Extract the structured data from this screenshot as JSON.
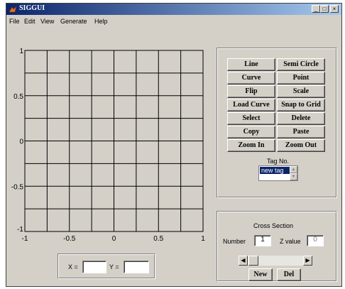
{
  "window": {
    "title": "SIGGUI",
    "controls": [
      "_",
      "□",
      "×"
    ]
  },
  "menu": [
    "File",
    "Edit",
    "View",
    "Generate",
    "Help"
  ],
  "plot": {
    "x_ticks": [
      "-1",
      "-0.5",
      "0",
      "0.5",
      "1"
    ],
    "y_ticks": [
      "1",
      "0.5",
      "0",
      "-0.5",
      "-1"
    ],
    "grid": true
  },
  "tools": {
    "buttons": [
      [
        "Line",
        "Semi Circle"
      ],
      [
        "Curve",
        "Point"
      ],
      [
        "Flip",
        "Scale"
      ],
      [
        "Load Curve",
        "Snap to Grid"
      ],
      [
        "Select",
        "Delete"
      ],
      [
        "Copy",
        "Paste"
      ],
      [
        "Zoom In",
        "Zoom Out"
      ]
    ],
    "tag_label": "Tag No.",
    "tag_value": "new tag"
  },
  "cross_section": {
    "title": "Cross Section",
    "number_label": "Number",
    "number_value": "1",
    "zvalue_label": "Z value",
    "zvalue_value": "0",
    "new_label": "New",
    "del_label": "Del"
  },
  "coords": {
    "x_label": "X =",
    "y_label": "Y =",
    "x_value": "",
    "y_value": ""
  }
}
